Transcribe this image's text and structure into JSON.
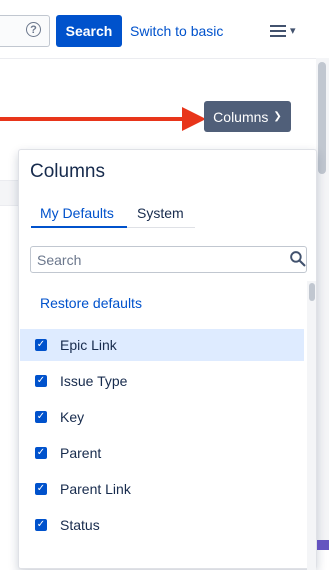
{
  "topbar": {
    "help_glyph": "?",
    "search_label": "Search",
    "switch_label": "Switch to basic",
    "menu_icon": "hamburger-icon"
  },
  "columns_button": {
    "label": "Columns",
    "chevron": "⌄"
  },
  "panel": {
    "title": "Columns",
    "tabs": [
      {
        "label": "My Defaults",
        "selected": true
      },
      {
        "label": "System",
        "selected": false
      }
    ],
    "search": {
      "placeholder": "Search",
      "value": ""
    },
    "restore_label": "Restore defaults",
    "items": [
      {
        "label": "Epic Link",
        "checked": true,
        "highlighted": true
      },
      {
        "label": "Issue Type",
        "checked": true
      },
      {
        "label": "Key",
        "checked": true
      },
      {
        "label": "Parent",
        "checked": true
      },
      {
        "label": "Parent Link",
        "checked": true
      },
      {
        "label": "Status",
        "checked": true
      }
    ]
  },
  "colors": {
    "primary": "#0052cc",
    "columns_button_bg": "#505f79",
    "arrow": "#e8351a",
    "highlight_row": "#deebff"
  }
}
